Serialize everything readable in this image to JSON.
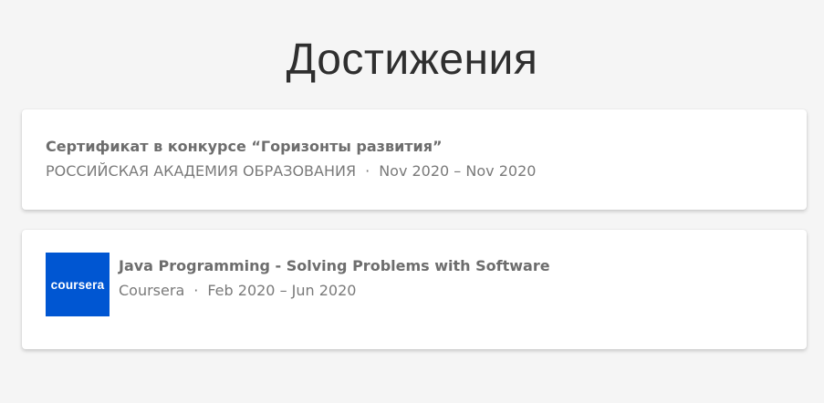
{
  "section": {
    "title": "Достижения"
  },
  "achievements": [
    {
      "title": "Сертификат в конкурсе “Горизонты развития”",
      "issuer": "РОССИЙСКАЯ АКАДЕМИЯ ОБРАЗОВАНИЯ",
      "separator": "·",
      "dates": "Nov 2020 – Nov 2020"
    },
    {
      "logo_text": "coursera",
      "logo_color": "#0056d2",
      "title": "Java Programming - Solving Problems with Software",
      "issuer": "Coursera",
      "separator": "·",
      "dates": "Feb 2020 – Jun 2020"
    }
  ]
}
